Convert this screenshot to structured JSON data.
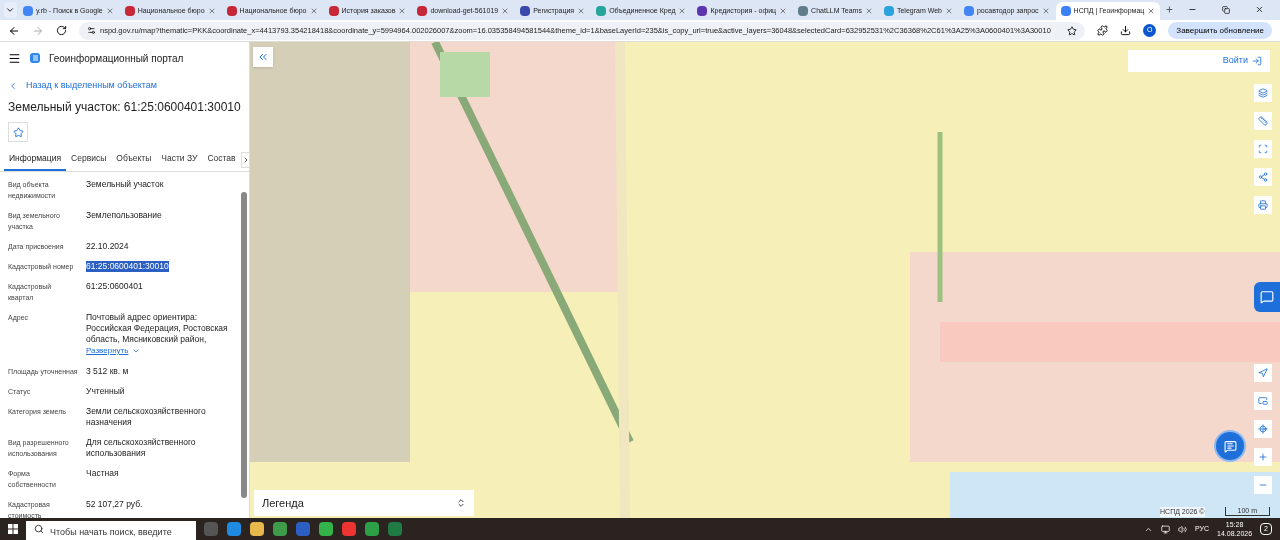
{
  "browser": {
    "tabs": [
      {
        "title": "у.rb - Поиск в Google",
        "selected": false,
        "color": "#4285f4"
      },
      {
        "title": "Национальное бюро",
        "selected": false,
        "color": "#c62838"
      },
      {
        "title": "Национальное бюро",
        "selected": false,
        "color": "#c62838"
      },
      {
        "title": "История заказов",
        "selected": false,
        "color": "#c62838"
      },
      {
        "title": "download-get-561019",
        "selected": false,
        "color": "#c62838"
      },
      {
        "title": "Регистрация",
        "selected": false,
        "color": "#3949ab"
      },
      {
        "title": "Объединенное Кред",
        "selected": false,
        "color": "#26a69a"
      },
      {
        "title": "Кредистория - офиц",
        "selected": false,
        "color": "#5e35b1"
      },
      {
        "title": "ChatLLM Teams",
        "selected": false,
        "color": "#607d8b"
      },
      {
        "title": "Telegram Web",
        "selected": false,
        "color": "#2aa3df"
      },
      {
        "title": "росавтодор запрос",
        "selected": false,
        "color": "#4285f4"
      },
      {
        "title": "НСПД | Геоинформац",
        "selected": true,
        "color": "#3b82f6"
      }
    ],
    "url": "nspd.gov.ru/map?thematic=PKK&coordinate_x=4413793.354218418&coordinate_y=5994964.002026007&zoom=16.035358494581544&theme_id=1&baseLayerId=235&is_copy_url=true&active_layers=36048&selectedCard=632952531%2C36368%2C61%3A25%3A0600401%3A30010",
    "profile": "О",
    "update_button": "Завершить обновление"
  },
  "panel": {
    "portal_title": "Геоинформационный портал",
    "back_link": "Назад к выделенным объектам",
    "heading": "Земельный участок: 61:25:0600401:30010",
    "tabs": [
      {
        "label": "Информация",
        "selected": true
      },
      {
        "label": "Сервисы",
        "selected": false
      },
      {
        "label": "Объекты",
        "selected": false
      },
      {
        "label": "Части ЗУ",
        "selected": false
      },
      {
        "label": "Состав",
        "selected": false
      }
    ],
    "fields": [
      {
        "label": "Вид объекта недвижимости",
        "value": "Земельный участок",
        "selected": false
      },
      {
        "label": "Вид земельного участка",
        "value": "Землепользование",
        "selected": false
      },
      {
        "label": "Дата присвоения",
        "value": "22.10.2024",
        "selected": false
      },
      {
        "label": "Кадастровый номер",
        "value": "61:25:0600401:30010",
        "selected": true
      },
      {
        "label": "Кадастровый квартал",
        "value": "61:25:0600401",
        "selected": false
      },
      {
        "label": "Адрес",
        "value": "Почтовый адрес ориентира: Российская Федерация, Ростовская область, Мясниковский район,",
        "selected": false,
        "expand_link": "Развернуть"
      },
      {
        "label": "Площадь уточненная",
        "value": "3 512 кв. м",
        "selected": false
      },
      {
        "label": "Статус",
        "value": "Учтенный",
        "selected": false
      },
      {
        "label": "Категория земель",
        "value": "Земли сельскохозяйственного назначения",
        "selected": false
      },
      {
        "label": "Вид разрешенного использования",
        "value": "Для сельскохозяйственного использования",
        "selected": false
      },
      {
        "label": "Форма собственности",
        "value": "Частная",
        "selected": false
      },
      {
        "label": "Кадастровая стоимость",
        "value": "52 107,27 руб.",
        "selected": false
      }
    ]
  },
  "map": {
    "login_button": "Войти",
    "legend": "Легенда",
    "copyright": "НСПД 2026 ©",
    "scale": "100 m"
  },
  "taskbar": {
    "search_placeholder": "Чтобы начать поиск, введите",
    "language": "РУС",
    "time": "15:28",
    "date": "14.08.2026",
    "notifications": "2"
  }
}
